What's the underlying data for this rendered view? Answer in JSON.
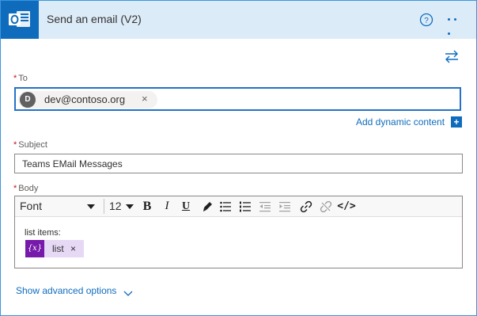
{
  "header": {
    "title": "Send an email (V2)",
    "app_icon": "outlook-icon",
    "help_icon": "help-circle-icon",
    "more_icon": "more-options-icon",
    "background": "#dcebf8",
    "accent": "#0f6cbd"
  },
  "swap_icon": "swap-arrows-icon",
  "to": {
    "label": "To",
    "required_mark": "*",
    "recipient": {
      "avatar_initial": "D",
      "email": "dev@contoso.org",
      "remove": "×"
    }
  },
  "dynamic_content": {
    "link": "Add dynamic content",
    "plus": "+"
  },
  "subject": {
    "label": "Subject",
    "required_mark": "*",
    "value": "Teams EMail Messages"
  },
  "body": {
    "label": "Body",
    "required_mark": "*",
    "toolbar": {
      "font": "Font",
      "font_size": "12",
      "bold": "B",
      "italic": "I",
      "underline": "U",
      "code_view": "</>"
    },
    "content_line": "list items:",
    "variable_token": {
      "icon_text": "{x}",
      "name": "list",
      "remove": "×"
    }
  },
  "advanced": {
    "link": "Show advanced options"
  }
}
